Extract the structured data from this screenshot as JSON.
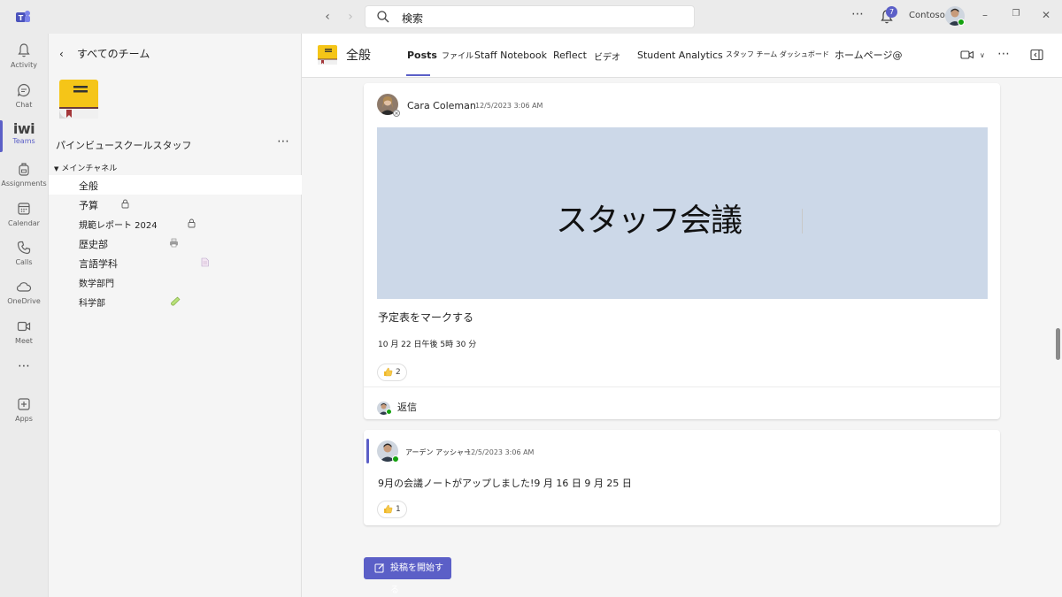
{
  "titlebar": {
    "search_placeholder": "検索",
    "notification_count": "7",
    "org_name": "Contoso"
  },
  "rail": {
    "items": [
      {
        "label": "Activity",
        "icon": "bell-icon"
      },
      {
        "label": "Chat",
        "icon": "chat-icon"
      },
      {
        "label": "Teams",
        "icon": "teams-icon",
        "glyph": "iwi"
      },
      {
        "label": "Assignments",
        "icon": "backpack-icon"
      },
      {
        "label": "Calendar",
        "icon": "calendar-icon"
      },
      {
        "label": "Calls",
        "icon": "phone-icon"
      },
      {
        "label": "OneDrive",
        "icon": "cloud-icon"
      },
      {
        "label": "Meet",
        "icon": "video-icon"
      },
      {
        "label": "",
        "icon": "more-icon"
      },
      {
        "label": "Apps",
        "icon": "apps-icon"
      }
    ]
  },
  "leftpane": {
    "back_label": "すべてのチーム",
    "team_name": "パインビュースクールスタッフ",
    "section_label": "メインチャネル",
    "channels": [
      {
        "label": "全般",
        "icon": ""
      },
      {
        "label": "予算",
        "icon": "lock-icon"
      },
      {
        "label": "規範レポート 2024",
        "icon": "lock-icon"
      },
      {
        "label": "歴史部",
        "icon": "printer-icon"
      },
      {
        "label": "言語学科",
        "icon": "document-icon"
      },
      {
        "label": "数学部門",
        "icon": ""
      },
      {
        "label": "科学部",
        "icon": "test-tube-icon"
      }
    ]
  },
  "channel_header": {
    "title": "全般",
    "tabs": [
      "Posts",
      "ファイル",
      "Staff Notebook",
      "Reflect",
      "ビデオ",
      "Student Analytics",
      "スタッフ チーム ダッシュボード",
      "ホームページ@"
    ]
  },
  "posts": [
    {
      "author": "Cara Coleman",
      "time": "12/5/2023 3:06 AM",
      "banner_text": "スタッフ会議",
      "line1": "予定表をマークする",
      "line2": "10 月 22 日午後 5時 30 分",
      "reaction_count": "2",
      "reply_label": "返信"
    },
    {
      "author": "アーデン アッシャー",
      "time": "12/5/2023 3:06 AM",
      "body": "9月の会議ノートがアップしました!9 月 16 日 9 月 25 日",
      "reaction_count": "1"
    }
  ],
  "new_post_label": "投稿を開始する",
  "colors": {
    "accent": "#5b5fc7",
    "banner_bg": "#ccd8e8",
    "online": "#13a10e"
  }
}
